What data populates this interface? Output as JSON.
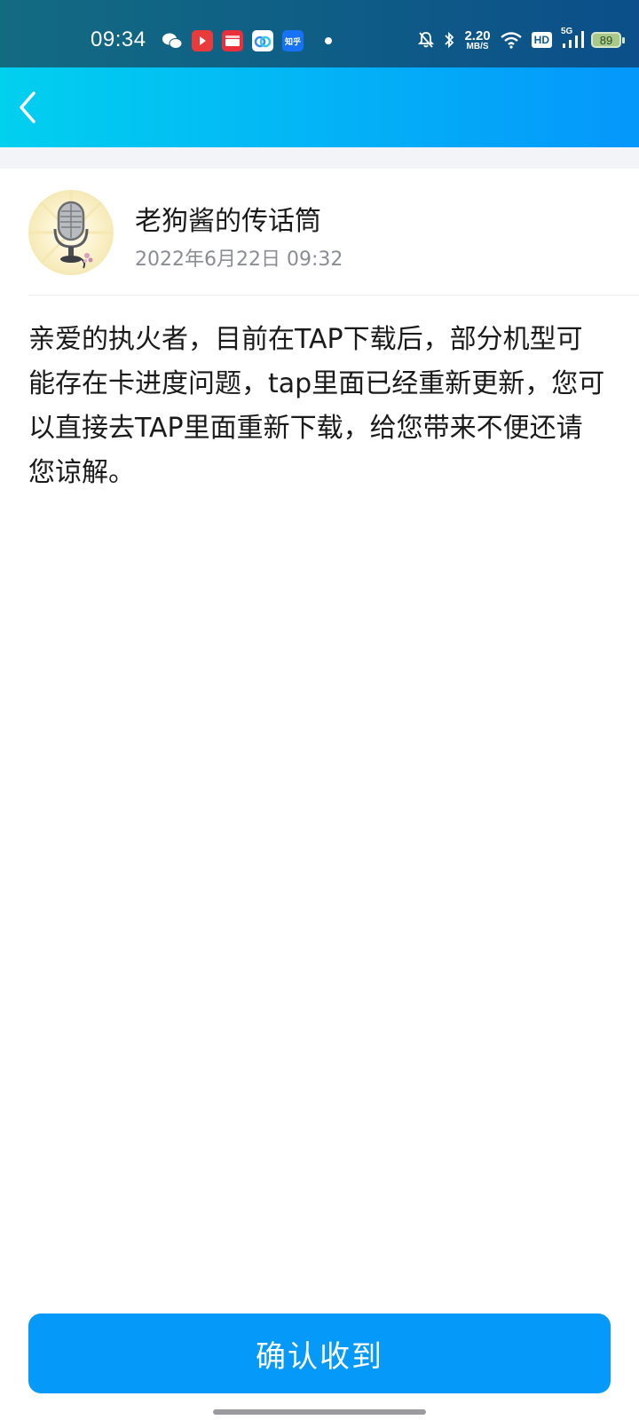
{
  "status_bar": {
    "time": "09:34",
    "net_speed_value": "2.20",
    "net_speed_unit": "MB/S",
    "hd_label": "HD",
    "signal_label": "5G",
    "battery_level": "89",
    "notif_zhihu_label": "知乎"
  },
  "nav": {
    "back_icon": "chevron-left-icon"
  },
  "author": {
    "name": "老狗酱的传话筒",
    "date": "2022年6月22日 09:32"
  },
  "message": {
    "body": "亲爱的执火者，目前在TAP下载后，部分机型可能存在卡进度问题，tap里面已经重新更新，您可以直接去TAP里面重新下载，给您带来不便还请您谅解。"
  },
  "actions": {
    "confirm_label": "确认收到"
  },
  "colors": {
    "accent": "#0599fa",
    "nav_gradient_start": "#02d0ef",
    "nav_gradient_end": "#0597fb"
  }
}
